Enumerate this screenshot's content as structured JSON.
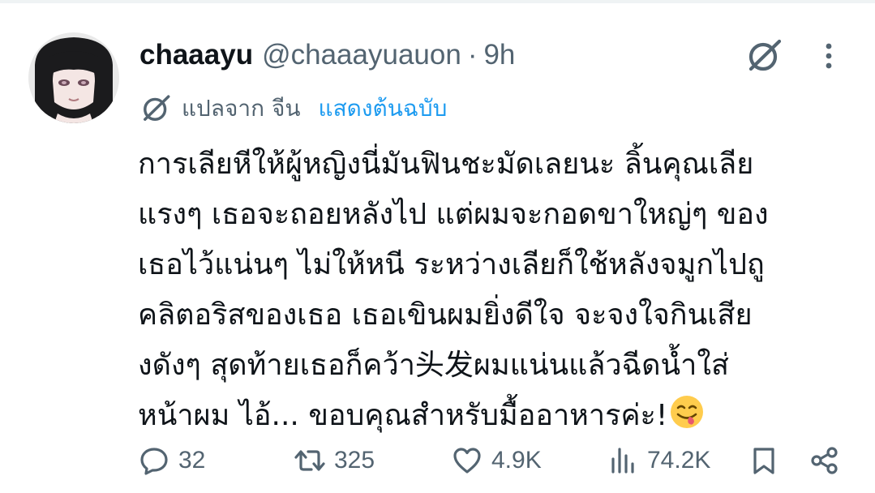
{
  "colors": {
    "text_primary": "#0f1419",
    "text_secondary": "#536471",
    "link": "#1d9bf0"
  },
  "tweet": {
    "author": {
      "display_name": "chaaayu",
      "handle": "@chaaayuauon",
      "separator": "·",
      "time": "9h",
      "avatar_icon": "avatar"
    },
    "header_icons": {
      "grok": "grok-icon",
      "more": "more-icon"
    },
    "translation": {
      "label": "แปลจาก จีน",
      "show_original": "แสดงต้นฉบับ",
      "icon": "grok-icon"
    },
    "text_lines": [
      "การเลียหีให้ผู้หญิงนี่มันฟินชะมัดเลยนะ ลิ้นคุณเลีย",
      "แรงๆ เธอจะถอยหลังไป แต่ผมจะกอดขาใหญ่ๆ ของ",
      "เธอไว้แน่นๆ ไม่ให้หนี ระหว่างเลียก็ใช้หลังจมูกไปถู",
      "คลิตอริสของเธอ เธอเขินผมยิ่งดีใจ จะจงใจกินเสีย",
      "งดังๆ สุดท้ายเธอก็คว้า头发ผมแน่นแล้วฉีดน้ำใส่",
      "หน้าผม ไอ้... ขอบคุณสำหรับมื้ออาหารค่ะ!"
    ],
    "trailing_emoji": "face-savoring-food-emoji",
    "actions": {
      "reply": {
        "icon": "reply-icon",
        "count": "32"
      },
      "repost": {
        "icon": "repost-icon",
        "count": "325"
      },
      "like": {
        "icon": "heart-icon",
        "count": "4.9K"
      },
      "views": {
        "icon": "views-icon",
        "count": "74.2K"
      },
      "bookmark": {
        "icon": "bookmark-icon"
      },
      "share": {
        "icon": "share-icon"
      }
    }
  }
}
